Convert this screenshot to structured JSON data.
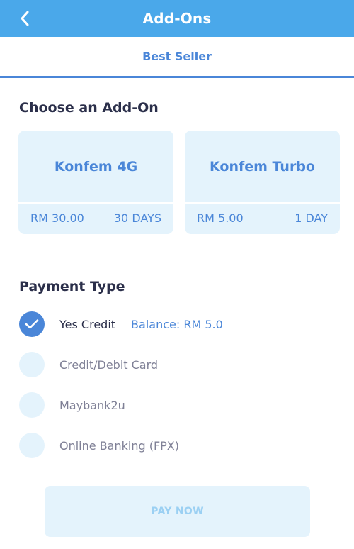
{
  "header": {
    "title": "Add-Ons",
    "back_icon": "chevron-left-icon"
  },
  "tabs": [
    {
      "label": "Best Seller",
      "active": true
    }
  ],
  "addons": {
    "title": "Choose an Add-On",
    "cards": [
      {
        "name": "Konfem 4G",
        "price": "RM 30.00",
        "duration": "30 DAYS"
      },
      {
        "name": "Konfem Turbo",
        "price": "RM 5.00",
        "duration": "1 DAY"
      }
    ]
  },
  "payment": {
    "title": "Payment Type",
    "options": [
      {
        "label": "Yes Credit",
        "selected": true,
        "balance": "Balance: RM 5.0"
      },
      {
        "label": "Credit/Debit Card",
        "selected": false
      },
      {
        "label": "Maybank2u",
        "selected": false
      },
      {
        "label": "Online Banking (FPX)",
        "selected": false
      }
    ]
  },
  "pay_button": {
    "label": "PAY NOW"
  },
  "colors": {
    "header_bg": "#4aa8ea",
    "accent": "#4a86d8",
    "card_bg": "#e4f3fc",
    "disabled_text": "#9bd0f3"
  }
}
